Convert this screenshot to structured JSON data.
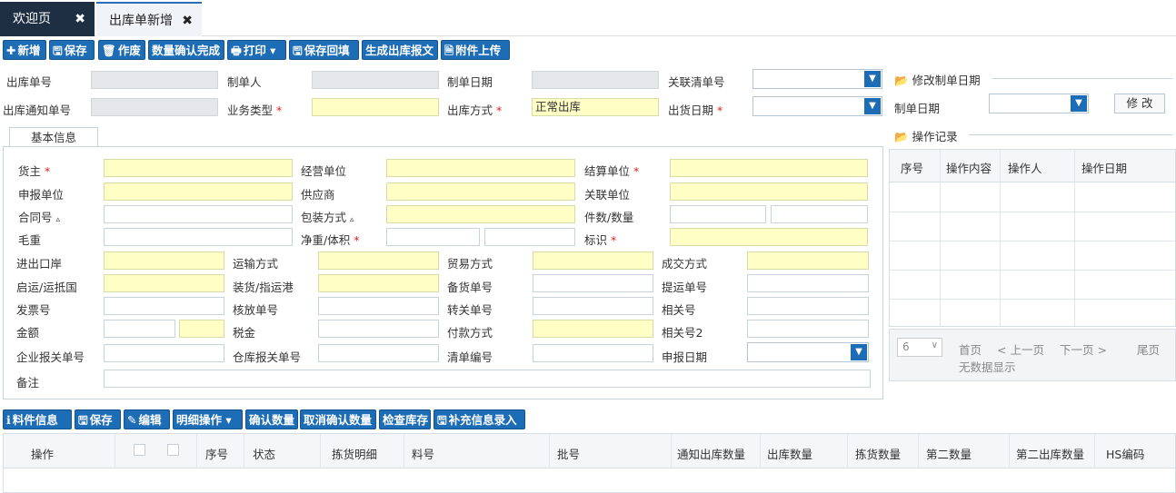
{
  "tabs": [
    {
      "label": "欢迎页",
      "close": "✖"
    },
    {
      "label": "出库单新增",
      "close": "✖"
    }
  ],
  "toolbar": [
    {
      "icon": "✚",
      "label": "新增"
    },
    {
      "icon": "🖫",
      "label": "保存"
    },
    {
      "icon": "🗑",
      "label": "作废"
    },
    {
      "icon": "",
      "label": "数量确认完成"
    },
    {
      "icon": "🖶",
      "label": "打印 ▾"
    },
    {
      "icon": "🖫",
      "label": "保存回填"
    },
    {
      "icon": "",
      "label": "生成出库报文"
    },
    {
      "icon": "🗎",
      "label": "附件上传"
    }
  ],
  "header_fields": {
    "outbound_no": "出库单号",
    "creator": "制单人",
    "create_date": "制单日期",
    "related_list_no": "关联清单号",
    "notice_no": "出库通知单号",
    "business_type": "业务类型",
    "outbound_method": "出库方式",
    "outbound_method_value": "正常出库",
    "ship_date": "出货日期",
    "required_mark": "*"
  },
  "right_panel": {
    "modify_legend": "修改制单日期",
    "create_date_label": "制单日期",
    "modify_button": "修 改",
    "log_legend": "操作记录",
    "log_columns": [
      "序号",
      "操作内容",
      "操作人",
      "操作日期"
    ],
    "page_size": "6",
    "pager": [
      "首页",
      "< 上一页",
      "下一页 >",
      "尾页"
    ],
    "empty": "无数据显示"
  },
  "basic_info": {
    "tab": "基本信息",
    "row1": [
      "货主",
      "经营单位",
      "结算单位"
    ],
    "row2": [
      "申报单位",
      "供应商",
      "关联单位"
    ],
    "row3": [
      "合同号",
      "包装方式",
      "件数/数量"
    ],
    "row4": [
      "毛重",
      "净重/体积",
      "标识"
    ],
    "marker": "▵",
    "grid_rows": [
      [
        "进出口岸",
        "运输方式",
        "贸易方式",
        "成交方式"
      ],
      [
        "启运/运抵国",
        "装货/指运港",
        "备货单号",
        "提运单号"
      ],
      [
        "发票号",
        "核放单号",
        "转关单号",
        "相关号"
      ],
      [
        "金额",
        "税金",
        "付款方式",
        "相关号2"
      ],
      [
        "企业报关单号",
        "仓库报关单号",
        "清单编号",
        "申报日期"
      ]
    ],
    "remark": "备注"
  },
  "detail_toolbar": [
    {
      "icon": "ℹ",
      "label": "料件信息"
    },
    {
      "icon": "🖫",
      "label": "保存"
    },
    {
      "icon": "✎",
      "label": "编辑"
    },
    {
      "icon": "",
      "label": "明细操作 ▾"
    },
    {
      "icon": "",
      "label": "确认数量"
    },
    {
      "icon": "",
      "label": "取消确认数量"
    },
    {
      "icon": "",
      "label": "检查库存"
    },
    {
      "icon": "🖫",
      "label": "补充信息录入"
    }
  ],
  "detail_columns": [
    "操作",
    "序号",
    "状态",
    "拣货明细",
    "料号",
    "批号",
    "通知出库数量",
    "出库数量",
    "拣货数量",
    "第二数量",
    "第二出库数量",
    "HS编码"
  ],
  "colors": {
    "accent": "#1d6cb6",
    "dark_tab": "#1e2f44",
    "required_bg": "#fefec5",
    "readonly_bg": "#e4e6e9"
  }
}
